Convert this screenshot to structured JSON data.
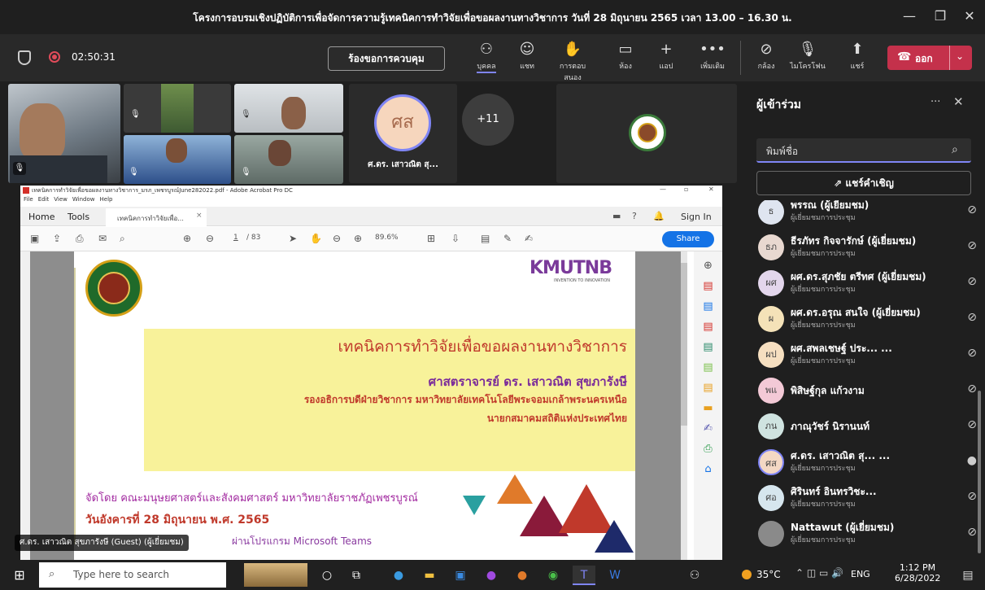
{
  "window": {
    "title": "โครงการอบรมเชิงปฏิบัติการเพื่อจัดการความรู้เทคนิคการทำวิจัยเพื่อขอผลงานทางวิชาการ วันที่ 28 มิถุนายน 2565 เวลา 13.00 – 16.30 น."
  },
  "meeting": {
    "timer": "02:50:31",
    "request_control": "ร้องขอการควบคุม",
    "leave": "ออก"
  },
  "toolbar": [
    {
      "icon": "people-icon",
      "label": "บุคคล"
    },
    {
      "icon": "chat-icon",
      "label": "แชท"
    },
    {
      "icon": "reactions-icon",
      "label": "การตอบสนอง"
    },
    {
      "icon": "rooms-icon",
      "label": "ห้อง"
    },
    {
      "icon": "apps-icon",
      "label": "แอป"
    },
    {
      "icon": "more-icon",
      "label": "เพิ่มเติม"
    },
    {
      "icon": "camera-off-icon",
      "label": "กล้อง"
    },
    {
      "icon": "mic-off-icon",
      "label": "ไมโครโฟน"
    },
    {
      "icon": "share-icon",
      "label": "แชร์"
    }
  ],
  "videos": {
    "avatar_initials": "ศส",
    "avatar_name": "ศ.ดร. เสาวณิต สุ...",
    "more_count": "+11"
  },
  "acrobat": {
    "title": "เทคนิคการทำวิจัยเพื่อขอผลงานทางวิชาการ_มรภ_เพชรบูรณ์June282022.pdf - Adobe Acrobat Pro DC",
    "menu": [
      "File",
      "Edit",
      "View",
      "Window",
      "Help"
    ],
    "tabs": {
      "home": "Home",
      "tools": "Tools",
      "doc": "เทคนิคการทำวิจัยเพื่อ...",
      "sign_in": "Sign In"
    },
    "page": "1",
    "pages": "/ 83",
    "zoom": "89.6%",
    "share": "Share"
  },
  "slide": {
    "logo": "KMUTNB",
    "logo_sub": "INVENTION TO INNOVATION",
    "heading": "เทคนิคการทำวิจัยเพื่อขอผลงานทางวิชาการ",
    "presenter": "ศาสตราจารย์ ดร. เสาวณิต สุขภารังษี",
    "position1": "รองอธิการบดีฝ่ายวิชาการ มหาวิทยาลัยเทคโนโลยีพระจอมเกล้าพระนครเหนือ",
    "position2": "นายกสมาคมสถิติแห่งประเทศไทย",
    "organizer": "จัดโดย คณะมนุษยศาสตร์และสังคมศาสตร์ มหาวิทยาลัยราชภัฏเพชรบูรณ์",
    "date": "วันอังคารที่ 28 มิถุนายน พ.ศ. 2565",
    "via": "ผ่านโปรแกรม Microsoft Teams"
  },
  "speaker_label": "ศ.ดร. เสาวณิต สุขภารังษี (Guest) (ผู้เยี่ยมชม)",
  "people": {
    "title": "ผู้เข้าร่วม",
    "search_placeholder": "พิมพ์ชื่อ",
    "share_invite": "แชร์คำเชิญ",
    "list": [
      {
        "initials": "ธ",
        "name": "พรรณ (ผู้เยี่ยมชม)",
        "sub": "ผู้เยี่ยมชมการประชุม",
        "color": "#dfe5f0",
        "mic": "off"
      },
      {
        "initials": "ธภ",
        "name": "ธีรภัทร กิจจารักษ์ (ผู้เยี่ยมชม)",
        "sub": "ผู้เยี่ยมชมการประชุม",
        "color": "#e8d8d0",
        "mic": "off"
      },
      {
        "initials": "ผศ",
        "name": "ผศ.ดร.สุภชัย ตรีทศ (ผู้เยี่ยมชม)",
        "sub": "ผู้เยี่ยมชมการประชุม",
        "color": "#e3d6ec",
        "mic": "off"
      },
      {
        "initials": "ผ",
        "name": "ผศ.ดร.อรุณ สนใจ (ผู้เยี่ยมชม)",
        "sub": "ผู้เยี่ยมชมการประชุม",
        "color": "#f4e2b8",
        "mic": "off"
      },
      {
        "initials": "ผป",
        "name": "ผศ.สพลเชษฐ์ ประ... ...",
        "sub": "ผู้เยี่ยมชมการประชุม",
        "color": "#f6dfc0",
        "mic": "off"
      },
      {
        "initials": "พแ",
        "name": "พิสิษฐ์กุล แก้วงาม",
        "sub": "",
        "color": "#f3c9d6",
        "mic": "off"
      },
      {
        "initials": "ภน",
        "name": "ภาณุวัชร์ นิรานนท์",
        "sub": "",
        "color": "#cfe3e0",
        "mic": "off"
      },
      {
        "initials": "ศส",
        "name": "ศ.ดร. เสาวณิต สุ... ...",
        "sub": "ผู้เยี่ยมชมการประชุม",
        "color": "#f4d8c4",
        "mic": "on"
      },
      {
        "initials": "ศอ",
        "name": "ศิรินทร์ อินทรวิชะ...",
        "sub": "ผู้เยี่ยมชมการประชุม",
        "color": "#d6e6ee",
        "mic": "off"
      },
      {
        "initials": "",
        "name": "Nattawut (ผู้เยี่ยมชม)",
        "sub": "ผู้เยี่ยมชมการประชุม",
        "color": "#8a8a8a",
        "mic": "off"
      }
    ]
  },
  "taskbar": {
    "search_placeholder": "Type here to search",
    "temperature": "35°C",
    "lang": "ENG",
    "time": "1:12 PM",
    "date": "6/28/2022"
  }
}
